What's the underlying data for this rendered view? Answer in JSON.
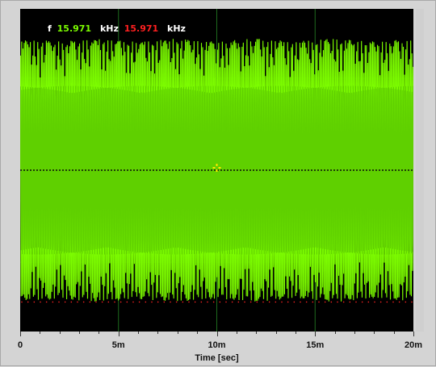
{
  "readout": {
    "label": "f",
    "value_green": "15.971",
    "unit_green": "kHz",
    "value_red": "15.971",
    "unit_red": "kHz"
  },
  "colors": {
    "plot_bg": "#000000",
    "trace": "#7cfc00",
    "trace_dark": "#5ac800",
    "grid": "#1e6b1e",
    "cursor": "#ffe600",
    "red": "#ff2020",
    "white": "#ffffff"
  },
  "chart_data": {
    "type": "line",
    "xlabel": "Time [sec]",
    "x_range_ms": [
      0,
      20
    ],
    "x_ticks": [
      "0",
      "5m",
      "10m",
      "15m",
      "20m"
    ],
    "y_range": [
      -1,
      1
    ],
    "grid": true,
    "series": [
      {
        "values_note_x": "time in ms",
        "x": [
          0,
          1,
          2,
          3,
          4,
          5,
          6,
          7,
          8,
          9,
          10,
          11,
          12,
          13,
          14,
          15,
          16,
          17,
          18,
          19,
          20
        ],
        "y_envelope": [
          0.85,
          0.85,
          0.84,
          0.85,
          0.86,
          0.85,
          0.84,
          0.85,
          0.86,
          0.85,
          0.84,
          0.85,
          0.86,
          0.85,
          0.84,
          0.85,
          0.86,
          0.85,
          0.84,
          0.85,
          0.85
        ]
      }
    ],
    "cursor": {
      "x_ms": 10,
      "y": 0
    }
  }
}
